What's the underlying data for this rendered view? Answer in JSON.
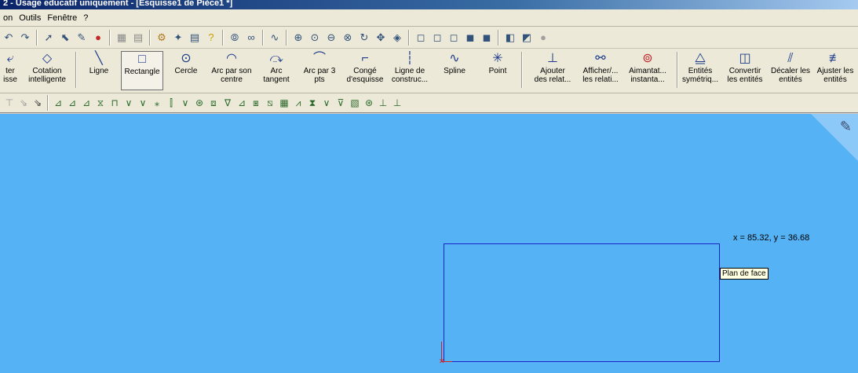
{
  "window": {
    "title": "2 - Usage educatif uniquement - [Esquisse1 de Pièce1 *]"
  },
  "menu": {
    "items": [
      "on",
      "Outils",
      "Fenêtre",
      "?"
    ]
  },
  "sketch_toolbar": {
    "items": [
      {
        "name": "exit-sketch",
        "label_1": "ter",
        "label_2": "isse"
      },
      {
        "name": "smart-dimension",
        "label_1": "Cotation",
        "label_2": "intelligente"
      },
      {
        "name": "line",
        "label_1": "Ligne",
        "label_2": ""
      },
      {
        "name": "rectangle",
        "label_1": "Rectangle",
        "label_2": ""
      },
      {
        "name": "circle",
        "label_1": "Cercle",
        "label_2": ""
      },
      {
        "name": "center-arc",
        "label_1": "Arc par son",
        "label_2": "centre"
      },
      {
        "name": "tangent-arc",
        "label_1": "Arc",
        "label_2": "tangent"
      },
      {
        "name": "three-point-arc",
        "label_1": "Arc par 3",
        "label_2": "pts"
      },
      {
        "name": "sketch-fillet",
        "label_1": "Congé",
        "label_2": "d'esquisse"
      },
      {
        "name": "construction-line",
        "label_1": "Ligne de",
        "label_2": "construc..."
      },
      {
        "name": "spline",
        "label_1": "Spline",
        "label_2": ""
      },
      {
        "name": "point",
        "label_1": "Point",
        "label_2": ""
      },
      {
        "name": "add-relation",
        "label_1": "Ajouter",
        "label_2": "des relat..."
      },
      {
        "name": "display-relations",
        "label_1": "Afficher/...",
        "label_2": "les relati..."
      },
      {
        "name": "quick-snaps",
        "label_1": "Aimantat...",
        "label_2": "instanta..."
      },
      {
        "name": "mirror-entities",
        "label_1": "Entités",
        "label_2": "symétriq..."
      },
      {
        "name": "convert-entities",
        "label_1": "Convertir",
        "label_2": "les entités"
      },
      {
        "name": "offset-entities",
        "label_1": "Décaler les",
        "label_2": "entités"
      },
      {
        "name": "trim-entities",
        "label_1": "Ajuster les",
        "label_2": "entités"
      }
    ]
  },
  "canvas": {
    "cursor_coords": "x = 85.32, y = 36.68",
    "tooltip": "Plan de face"
  },
  "colors": {
    "canvas_bg": "#55b2f5",
    "sketch_line": "#1a22c8",
    "origin": "#d42020"
  }
}
